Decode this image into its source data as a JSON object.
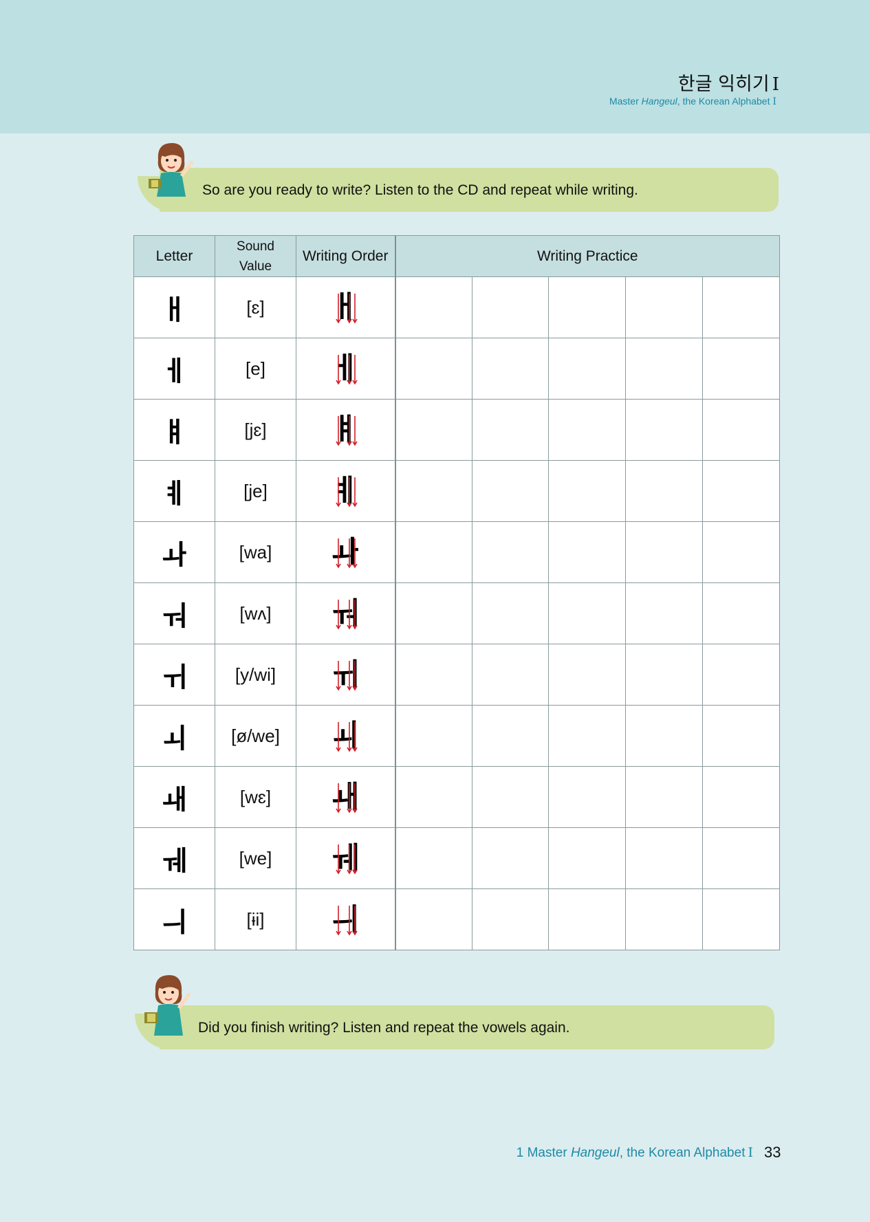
{
  "header": {
    "title": "한글 익히기",
    "title_suffix": "I",
    "subtitle_pre": "Master ",
    "subtitle_em": "Hangeul",
    "subtitle_post": ", the Korean Alphabet",
    "subtitle_suffix": "I"
  },
  "intro": {
    "text": "So are you ready to write? Listen to the CD and repeat while writing."
  },
  "table": {
    "headers": {
      "letter": "Letter",
      "sound_1": "Sound",
      "sound_2": "Value",
      "order": "Writing Order",
      "practice": "Writing Practice"
    },
    "rows": [
      {
        "letter": "ㅐ",
        "sound": "[ɛ]"
      },
      {
        "letter": "ㅔ",
        "sound": "[e]"
      },
      {
        "letter": "ㅒ",
        "sound": "[jɛ]"
      },
      {
        "letter": "ㅖ",
        "sound": "[je]"
      },
      {
        "letter": "ㅘ",
        "sound": "[wa]"
      },
      {
        "letter": "ㅝ",
        "sound": "[wʌ]"
      },
      {
        "letter": "ㅟ",
        "sound": "[y/wi]"
      },
      {
        "letter": "ㅚ",
        "sound": "[ø/we]"
      },
      {
        "letter": "ㅙ",
        "sound": "[wɛ]"
      },
      {
        "letter": "ㅞ",
        "sound": "[we]"
      },
      {
        "letter": "ㅢ",
        "sound": "[ɨi]"
      }
    ]
  },
  "outro": {
    "text": "Did you finish writing?  Listen and repeat the vowels again."
  },
  "footer": {
    "pre": "1 Master ",
    "em": "Hangeul",
    "post": ", the Korean Alphabet",
    "suffix": "I",
    "page": "33"
  },
  "colors": {
    "header_band": "#bde0e2",
    "page_bg": "#dcedef",
    "bubble": "#cfe0a0",
    "table_header": "#c5dfe0",
    "accent_text": "#1d8aa6",
    "stroke_arrow": "#d0202a"
  }
}
